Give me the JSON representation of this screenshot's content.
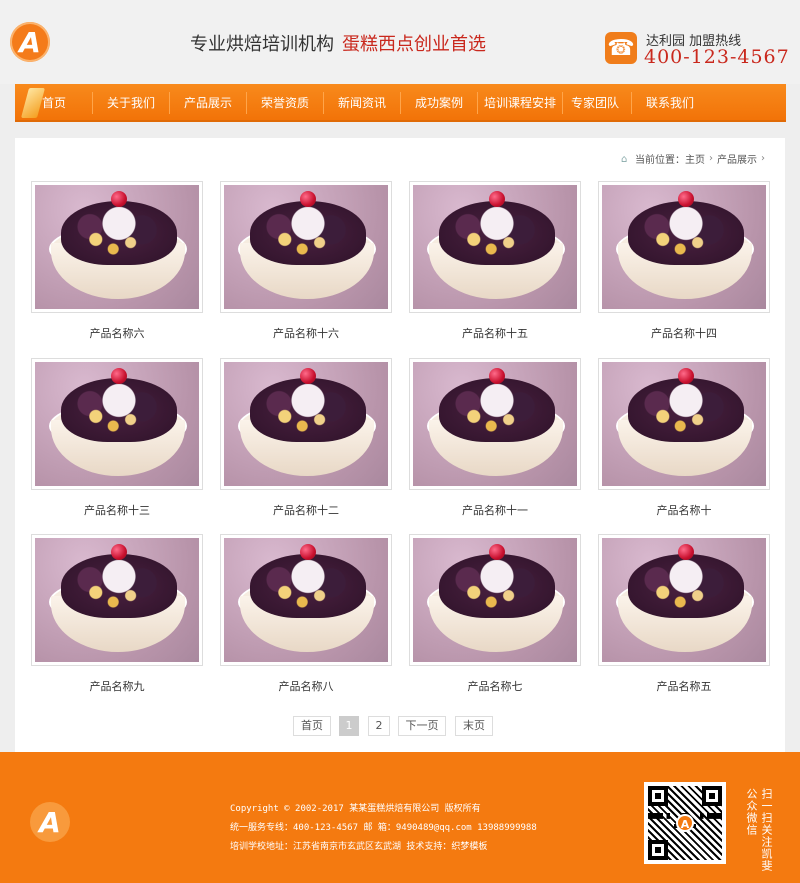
{
  "header": {
    "logo_letter": "A",
    "slogan_main": "专业烘焙培训机构",
    "slogan_accent": "蛋糕西点创业首选",
    "hotline_label": "达利园 加盟热线",
    "hotline_number": "400-123-4567",
    "phone_icon": "phone-icon"
  },
  "nav": {
    "items": [
      {
        "label": "首页"
      },
      {
        "label": "关于我们"
      },
      {
        "label": "产品展示"
      },
      {
        "label": "荣誉资质"
      },
      {
        "label": "新闻资讯"
      },
      {
        "label": "成功案例"
      },
      {
        "label": "培训课程安排"
      },
      {
        "label": "专家团队"
      },
      {
        "label": "联系我们"
      }
    ],
    "active_index": 0
  },
  "breadcrumb": {
    "prefix": "当前位置：",
    "home": "主页",
    "current": "产品展示"
  },
  "products": [
    {
      "name": "产品名称六"
    },
    {
      "name": "产品名称十六"
    },
    {
      "name": "产品名称十五"
    },
    {
      "name": "产品名称十四"
    },
    {
      "name": "产品名称十三"
    },
    {
      "name": "产品名称十二"
    },
    {
      "name": "产品名称十一"
    },
    {
      "name": "产品名称十"
    },
    {
      "name": "产品名称九"
    },
    {
      "name": "产品名称八"
    },
    {
      "name": "产品名称七"
    },
    {
      "name": "产品名称五"
    }
  ],
  "pagination": {
    "first": "首页",
    "page1": "1",
    "page2": "2",
    "next": "下一页",
    "last": "末页",
    "current_page": 1
  },
  "footer": {
    "copyright": "Copyright © 2002-2017 某某蛋糕烘焙有限公司 版权所有",
    "service_line": "统一服务专线：400-123-4567 邮 箱：9490489@qq.com 13988999988",
    "address_prefix": "培训学校地址：江苏省南京市玄武区玄武湖 技术支持：",
    "tech_support": "织梦模板",
    "qr_caption": "扫一扫关注凯斐公众微信"
  },
  "colors": {
    "brand_orange": "#f47a10",
    "accent_red": "#c9281d"
  }
}
